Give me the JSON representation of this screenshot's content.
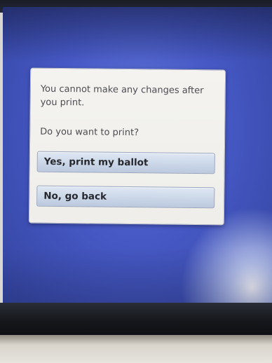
{
  "dialog": {
    "message": "You cannot make any changes after you print.",
    "question": "Do you want to print?",
    "yes_label": "Yes, print my ballot",
    "no_label": "No, go back"
  },
  "colors": {
    "screen_background": "#4658c4",
    "dialog_background": "#f2f1ed",
    "button_background": "#cbd7e8",
    "text": "#4c4c52"
  }
}
